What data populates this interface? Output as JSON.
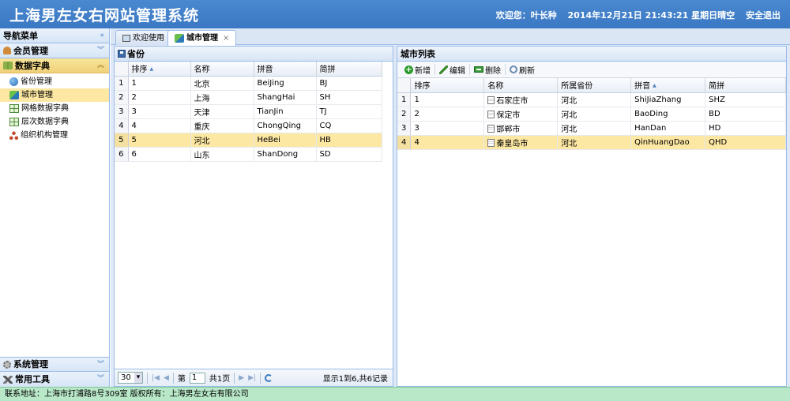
{
  "header": {
    "title": "上海男左女右网站管理系统",
    "welcome": "欢迎您：叶长种",
    "datetime": "2014年12月21日 21:43:21 星期日",
    "weather": "晴空 ",
    "logout": "安全退出"
  },
  "sidebar": {
    "title": "导航菜单",
    "member": "会员管理",
    "dict": "数据字典",
    "items": [
      {
        "label": "省份管理",
        "icon": "database-icon"
      },
      {
        "label": "城市管理",
        "icon": "city-icon"
      },
      {
        "label": "网格数据字典",
        "icon": "grid-icon"
      },
      {
        "label": "层次数据字典",
        "icon": "grid-icon"
      },
      {
        "label": "组织机构管理",
        "icon": "org-tree-icon"
      }
    ],
    "system": "系统管理",
    "tools": "常用工具"
  },
  "tabs": [
    {
      "label": "欢迎使用"
    },
    {
      "label": "城市管理"
    }
  ],
  "province_panel": {
    "title": "省份",
    "columns": [
      "排序",
      "名称",
      "拼音",
      "简拼"
    ],
    "rows": [
      {
        "rn": "1",
        "order": "1",
        "name": "北京",
        "pinyin": "BeiJing",
        "abbr": "BJ"
      },
      {
        "rn": "2",
        "order": "2",
        "name": "上海",
        "pinyin": "ShangHai",
        "abbr": "SH"
      },
      {
        "rn": "3",
        "order": "3",
        "name": "天津",
        "pinyin": "TianJin",
        "abbr": "TJ"
      },
      {
        "rn": "4",
        "order": "4",
        "name": "重庆",
        "pinyin": "ChongQing",
        "abbr": "CQ"
      },
      {
        "rn": "5",
        "order": "5",
        "name": "河北",
        "pinyin": "HeBei",
        "abbr": "HB"
      },
      {
        "rn": "6",
        "order": "6",
        "name": "山东",
        "pinyin": "ShanDong",
        "abbr": "SD"
      }
    ],
    "selected_index": 4,
    "pager": {
      "page_size": "30",
      "page_prefix": "第",
      "page_value": "1",
      "page_suffix": "共1页",
      "info": "显示1到6,共6记录"
    }
  },
  "city_panel": {
    "title": "城市列表",
    "toolbar": {
      "add": "新增",
      "edit": "编辑",
      "delete": "删除",
      "refresh": "刷新"
    },
    "columns": [
      "排序",
      "名称",
      "所属省份",
      "拼音",
      "简拼"
    ],
    "rows": [
      {
        "rn": "1",
        "order": "1",
        "name": "石家庄市",
        "province": "河北",
        "pinyin": "ShiJiaZhang",
        "abbr": "SHZ"
      },
      {
        "rn": "2",
        "order": "2",
        "name": "保定市",
        "province": "河北",
        "pinyin": "BaoDing",
        "abbr": "BD"
      },
      {
        "rn": "3",
        "order": "3",
        "name": "邯郸市",
        "province": "河北",
        "pinyin": "HanDan",
        "abbr": "HD"
      },
      {
        "rn": "4",
        "order": "4",
        "name": "秦皇岛市",
        "province": "河北",
        "pinyin": "QinHuangDao",
        "abbr": "QHD"
      }
    ],
    "selected_index": 3
  },
  "footer": {
    "text": "联系地址：上海市打浦路8号309室 版权所有：上海男左女右有限公司"
  }
}
